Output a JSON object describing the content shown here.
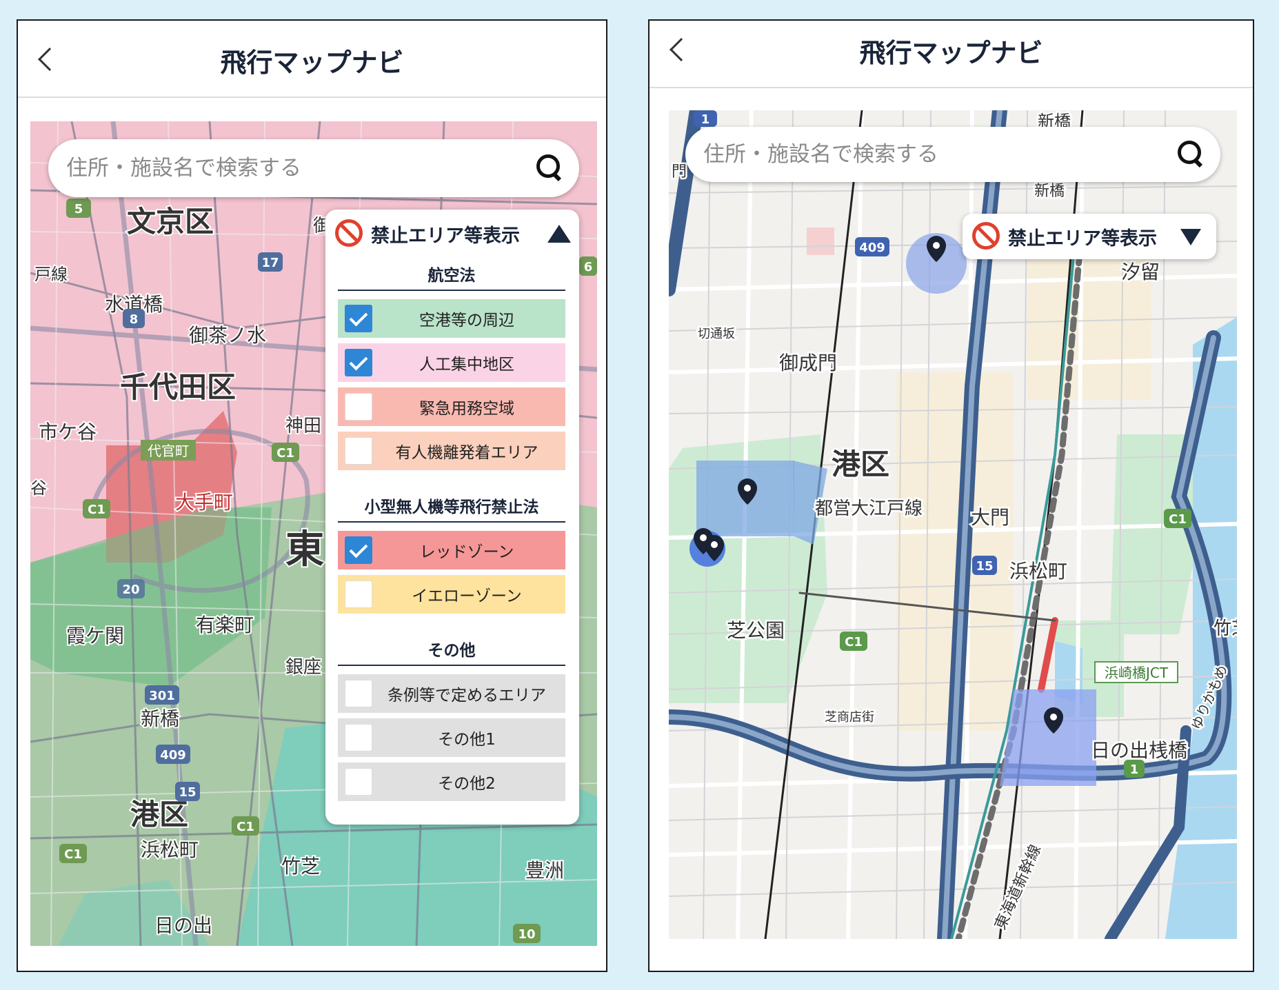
{
  "left_screen": {
    "header": {
      "title": "飛行マップナビ"
    },
    "search": {
      "placeholder": "住所・施設名で検索する"
    },
    "layer_panel": {
      "title": "禁止エリア等表示",
      "sections": [
        {
          "heading": "航空法",
          "options": [
            {
              "label": "空港等の周辺",
              "checked": true,
              "color": "#b9e4c9"
            },
            {
              "label": "人工集中地区",
              "checked": true,
              "color": "#fbd3e6"
            },
            {
              "label": "緊急用務空域",
              "checked": false,
              "color": "#f9b9b1"
            },
            {
              "label": "有人機離発着エリア",
              "checked": false,
              "color": "#fbd0bd"
            }
          ]
        },
        {
          "heading": "小型無人機等飛行禁止法",
          "options": [
            {
              "label": "レッドゾーン",
              "checked": true,
              "color": "#f59797"
            },
            {
              "label": "イエローゾーン",
              "checked": false,
              "color": "#fde39d"
            }
          ]
        },
        {
          "heading": "その他",
          "options": [
            {
              "label": "条例等で定めるエリア",
              "checked": false,
              "color": "#e0e0e0"
            },
            {
              "label": "その他1",
              "checked": false,
              "color": "#e0e0e0"
            },
            {
              "label": "その他2",
              "checked": false,
              "color": "#e0e0e0"
            }
          ]
        }
      ]
    },
    "map_labels": {
      "bunkyo": "文京区",
      "chiyoda": "千代田区",
      "minato": "港区",
      "suidobashi": "水道橋",
      "ochanomizu": "御茶ノ水",
      "ichigaya": "市ケ谷",
      "daikanmachi": "代官町",
      "kanda": "神田",
      "otemachi": "大手町",
      "kasumigaseki": "霞ケ関",
      "yurakucho": "有楽町",
      "ginza": "銀座",
      "shinbashi": "新橋",
      "hamamatsucho": "浜松町",
      "takeshiba": "竹芝",
      "toyosu": "豊洲",
      "hinode": "日の出",
      "higashi": "東",
      "sen": "戸線",
      "go": "御",
      "tani": "谷",
      "shields": [
        "5",
        "17",
        "8",
        "C1",
        "C1",
        "20",
        "301",
        "409",
        "15",
        "C1",
        "C1",
        "6",
        "10"
      ]
    }
  },
  "right_screen": {
    "header": {
      "title": "飛行マップナビ"
    },
    "search": {
      "placeholder": "住所・施設名で検索する"
    },
    "layer_toggle": {
      "title": "禁止エリア等表示"
    },
    "map_labels": {
      "minato": "港区",
      "shiodome": "汐留",
      "onarimon": "御成門",
      "kiridoshizaka": "切通坂",
      "oedo_line": "都営大江戸線",
      "daimon": "大門",
      "hamamatsucho": "浜松町",
      "shibakoen": "芝公園",
      "shiba_shotengai": "芝商店街",
      "hamazakibashi_jct": "浜崎橋JCT",
      "hinode_pier": "日の出桟橋",
      "shinkansen": "東海道新幹線",
      "yurikamome": "ゆりかもめ",
      "take": "竹芝",
      "shinbashi_top": "新橋",
      "shinbashi2": "新橋",
      "mon": "門",
      "shields": [
        "1",
        "409",
        "15",
        "C1",
        "C1",
        "1"
      ]
    }
  }
}
